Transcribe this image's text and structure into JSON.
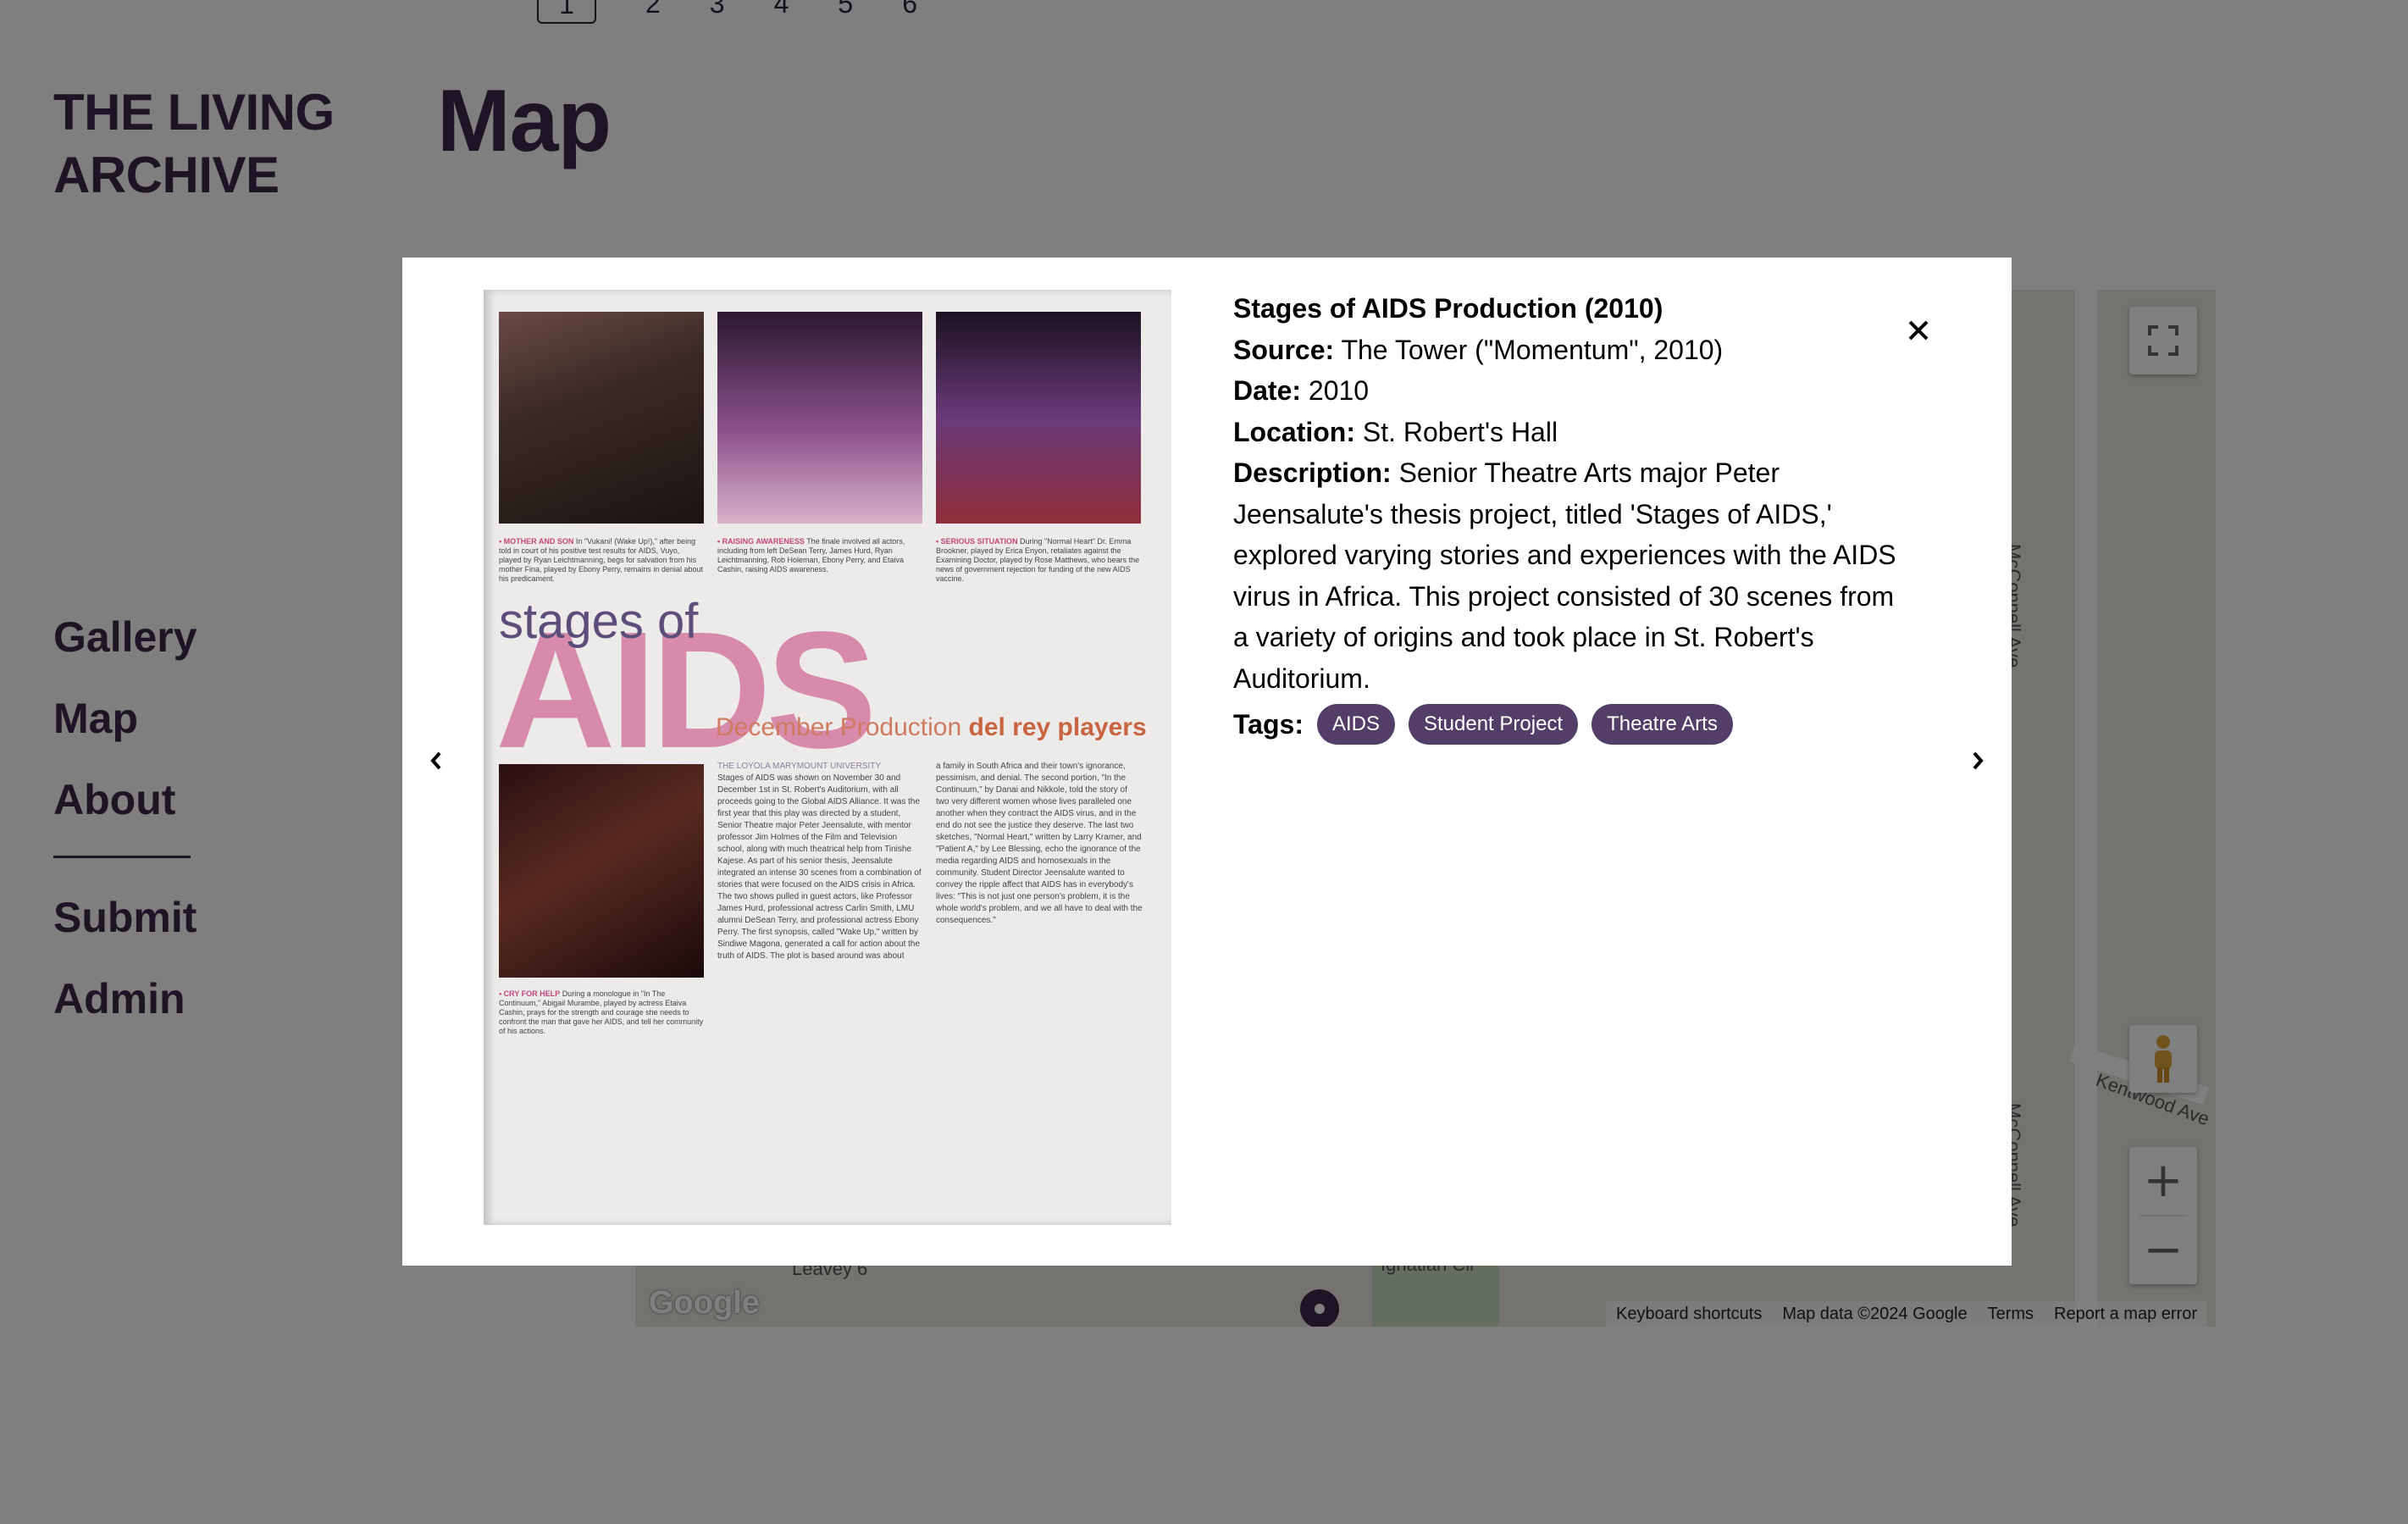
{
  "pagination": {
    "current": "1",
    "pages": [
      "2",
      "3",
      "4",
      "5",
      "6"
    ]
  },
  "site": {
    "title": "THE LIVING ARCHIVE"
  },
  "page": {
    "heading": "Map"
  },
  "nav": {
    "primary": [
      "Gallery",
      "Map",
      "About"
    ],
    "secondary": [
      "Submit",
      "Admin"
    ]
  },
  "map": {
    "roads": [
      "McConnell Ave",
      "McConnell Ave",
      "Kentwood Ave",
      "Leavey 6",
      "Ignatian Cir"
    ],
    "logo": "Google",
    "attribution": [
      "Keyboard shortcuts",
      "Map data ©2024 Google",
      "Terms",
      "Report a map error"
    ],
    "zoom_in": "+",
    "zoom_out": "−"
  },
  "item": {
    "title": "Stages of AIDS Production (2010)",
    "source_label": "Source:",
    "source": "The Tower (\"Momentum\", 2010)",
    "date_label": "Date:",
    "date": "2010",
    "location_label": "Location:",
    "location": "St. Robert's Hall",
    "description_label": "Description:",
    "description": "Senior Theatre Arts major Peter Jeensalute's thesis project, titled 'Stages of AIDS,' explored varying stories and experiences with the AIDS virus in Africa. This project consisted of 30 scenes from a variety of origins and took place in St. Robert's Auditorium.",
    "tags_label": "Tags:",
    "tags": [
      "AIDS",
      "Student Project",
      "Theatre Arts"
    ]
  },
  "magazine": {
    "stages": "stages of",
    "aids": "AIDS",
    "subtitle": "December Production",
    "subtitle_emph": "del rey players",
    "caption1_head": "• MOTHER AND SON",
    "caption1": "In \"Vukani! (Wake Up!),\" after being told in court of his positive test results for AIDS, Vuyo, played by Ryan Leichtmanning, begs for salvation from his mother Fina, played by Ebony Perry, remains in denial about his predicament.",
    "caption2_head": "• RAISING AWARENESS",
    "caption2": "The finale involved all actors, including from left DeSean Terry, James Hurd, Ryan Leichtmanning, Rob Holeman, Ebony Perry, and Etaiva Cashin, raising AIDS awareness.",
    "caption3_head": "• SERIOUS SITUATION",
    "caption3": "During \"Normal Heart\" Dr. Emma Brookner, played by Erica Enyon, retaliates against the Examining Doctor, played by Rose Matthews, who bears the news of government rejection for funding of the new AIDS vaccine.",
    "caption4_head": "• CRY FOR HELP",
    "caption4": "During a monologue in \"In The Continuum,\" Abigail Murambe, played by actress Etaiva Cashin, prays for the strength and courage she needs to confront the man that gave her AIDS, and tell her community of his actions.",
    "col1_head": "THE LOYOLA MARYMOUNT UNIVERSITY",
    "col1": "Stages of AIDS was shown on November 30 and December 1st in St. Robert's Auditorium, with all proceeds going to the Global AIDS Alliance. It was the first year that this play was directed by a student, Senior Theatre major Peter Jeensalute, with mentor professor Jim Holmes of the Film and Television school, along with much theatrical help from Tinishe Kajese. As part of his senior thesis, Jeensalute integrated an intense 30 scenes from a combination of stories that were focused on the AIDS crisis in Africa. The two shows pulled in guest actors, like Professor James Hurd, professional actress Carlin Smith, LMU alumni DeSean Terry, and professional actress Ebony Perry. The first synopsis, called \"Wake Up,\" written by Sindiwe Magona, generated a call for action about the truth of AIDS. The plot is based around was about",
    "col2": "a family in South Africa and their town's ignorance, pessimism, and denial. The second portion, \"In the Continuum,\" by Danai and Nikkole, told the story of two very different women whose lives paralleled one another when they contract the AIDS virus, and in the end do not see the justice they deserve. The last two sketches, \"Normal Heart,\" written by Larry Kramer, and \"Patient A,\" by Lee Blessing, echo the ignorance of the media regarding AIDS and homosexuals in the community. Student Director Jeensalute wanted to convey the ripple affect that AIDS has in everybody's lives: \"This is not just one person's problem, it is the whole world's problem, and we all have to deal with the consequences.\""
  }
}
